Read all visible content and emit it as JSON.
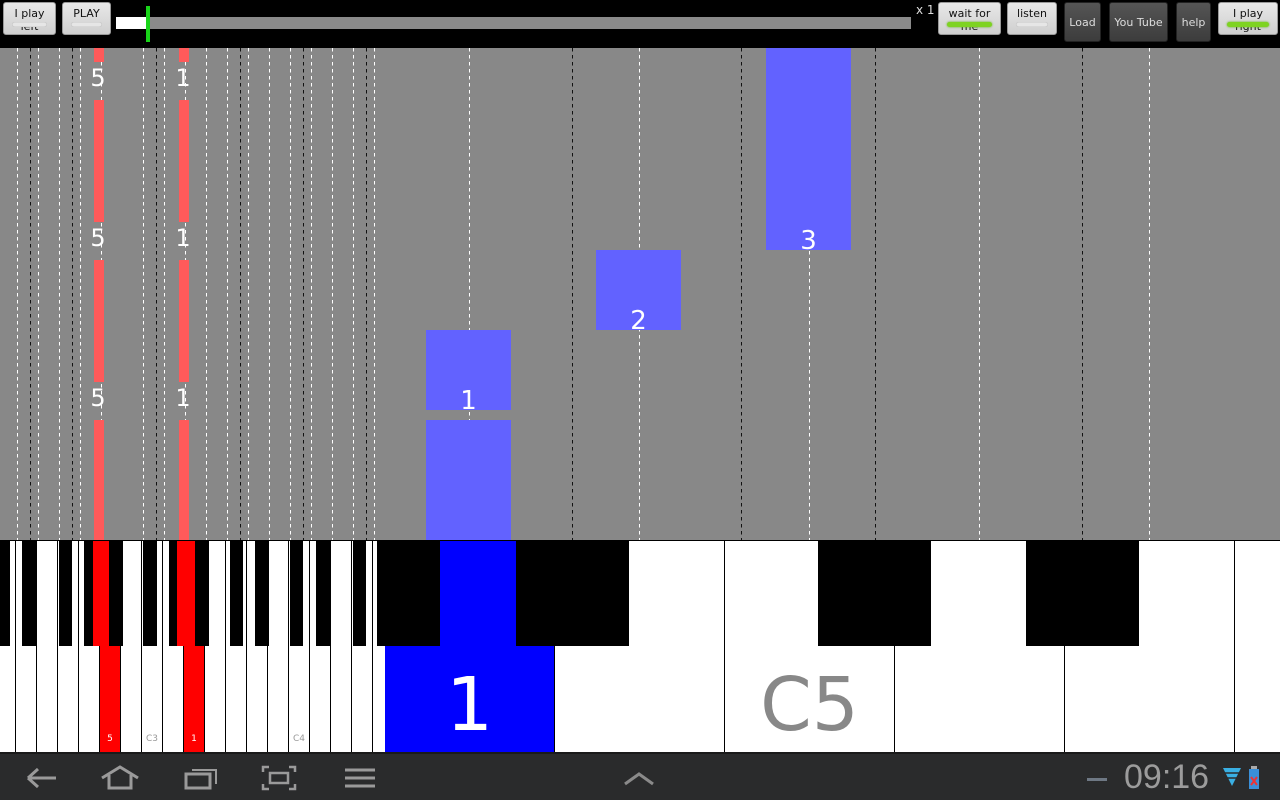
{
  "toolbar": {
    "play_left_label": "I play left",
    "play_label": "PLAY",
    "speed_label": "x 1",
    "wait_label": "wait for me",
    "listen_label": "listen",
    "load_label": "Load",
    "youtube_label": "You Tube",
    "help_label": "help",
    "play_right_label": "I play right",
    "play_left_active": false,
    "play_active": false,
    "wait_active": true,
    "listen_active": false,
    "play_right_active": true,
    "progress_percent": 4
  },
  "colors": {
    "left_hand": "#ff0000",
    "left_hand_lane": "#ff5a5a",
    "right_hand": "#0000ff",
    "right_hand_lane": "#6262ff",
    "lane_bg": "#888888",
    "progress_thumb": "#19d419"
  },
  "lanes": {
    "left_hand_fingers": [
      {
        "finger": "5",
        "labels": [
          "5",
          "5",
          "5"
        ]
      },
      {
        "finger": "1",
        "labels": [
          "1",
          "1",
          "1"
        ]
      }
    ],
    "right_hand_notes": [
      {
        "finger": "1"
      },
      {
        "finger": "1"
      },
      {
        "finger": "2"
      },
      {
        "finger": "3"
      }
    ]
  },
  "keyboard": {
    "small_labels": {
      "left5": "5",
      "c3": "C3",
      "left1": "1",
      "c4": "C4"
    },
    "big_labels": {
      "pressed": "1",
      "c5": "C5"
    }
  },
  "navbar": {
    "icons": [
      "back-icon",
      "home-icon",
      "recent-apps-icon",
      "screenshot-icon",
      "menu-icon"
    ],
    "clock": "09:16"
  }
}
